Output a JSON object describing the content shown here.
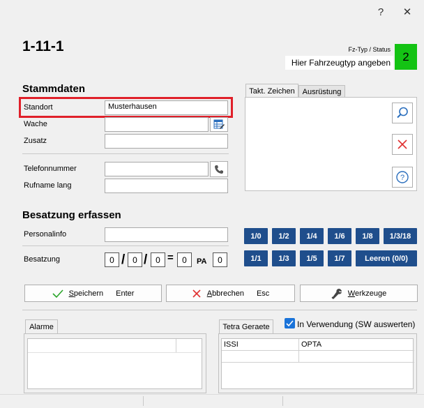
{
  "window": {
    "help_label": "?",
    "close_label": "✕"
  },
  "header": {
    "title": "1-11-1",
    "fz_typ_label": "Fz-Typ / Status",
    "fahrzeugtyp_value": "Hier Fahrzeugtyp angeben",
    "status_value": "2",
    "status_color": "#14c314"
  },
  "stammdaten": {
    "heading": "Stammdaten",
    "standort_label": "Standort",
    "standort_value": "Musterhausen",
    "wache_label": "Wache",
    "wache_value": "",
    "zusatz_label": "Zusatz",
    "zusatz_value": "",
    "telefon_label": "Telefonnummer",
    "telefon_value": "",
    "rufname_label": "Rufname lang",
    "rufname_value": ""
  },
  "tabs": {
    "takt_label": "Takt. Zeichen",
    "ausruestung_label": "Ausrüstung"
  },
  "besatzung": {
    "heading": "Besatzung erfassen",
    "personalinfo_label": "Personalinfo",
    "personalinfo_value": "",
    "besatzung_label": "Besatzung",
    "v1": "0",
    "v2": "0",
    "v3": "0",
    "total": "0",
    "pa_label": "PA",
    "pa_value": "0",
    "slash": "/",
    "equals": "="
  },
  "quick_buttons": [
    "1/0",
    "1/2",
    "1/4",
    "1/6",
    "1/8",
    "1/3/18",
    "1/1",
    "1/3",
    "1/5",
    "1/7",
    "Leeren (0/0)"
  ],
  "actions": {
    "save_prefix": "",
    "save_underline": "S",
    "save_rest": "peichern",
    "save_key": "Enter",
    "cancel_underline": "A",
    "cancel_rest": "bbrechen",
    "cancel_key": "Esc",
    "tools_underline": "W",
    "tools_rest": "erkzeuge"
  },
  "alarme": {
    "tab_label": "Alarme"
  },
  "tetra": {
    "tab_label": "Tetra Geraete",
    "checkbox_label": "In Verwendung (SW auswerten)",
    "col_issi": "ISSI",
    "col_opta": "OPTA"
  },
  "colors": {
    "highlight": "#e0202a",
    "button_blue": "#1f4e8c",
    "icon_blue": "#2a6ebd",
    "icon_red": "#e03030"
  }
}
